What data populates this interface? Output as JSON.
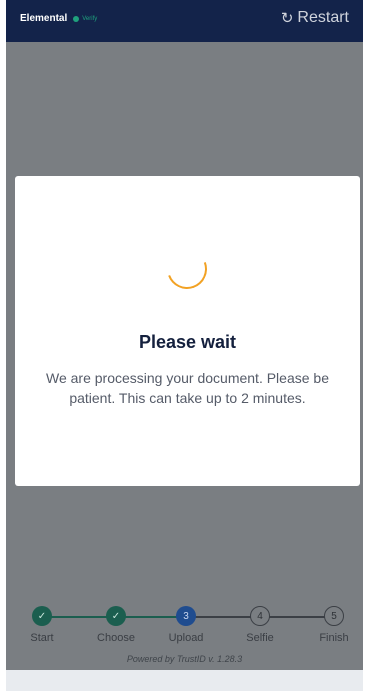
{
  "header": {
    "brand": "Elemental",
    "brand_sub": "Verify",
    "restart_icon": "restart-icon",
    "restart_label": "Restart"
  },
  "modal": {
    "title": "Please wait",
    "body": "We are processing your document. Please be patient. This can take up to 2 minutes.",
    "spinner_color": "#f2a224"
  },
  "stepper": {
    "steps": [
      {
        "number": "1",
        "label": "Start",
        "status": "done"
      },
      {
        "number": "2",
        "label": "Choose",
        "status": "done"
      },
      {
        "number": "3",
        "label": "Upload",
        "status": "active"
      },
      {
        "number": "4",
        "label": "Selfie",
        "status": "pending"
      },
      {
        "number": "5",
        "label": "Finish",
        "status": "pending"
      }
    ],
    "check_glyph": "✓",
    "powered_by": "Powered by TrustID v. 1.28.3"
  },
  "colors": {
    "header_bg": "#13234a",
    "done": "#1b5e4f",
    "active": "#1f4c8f",
    "overlay": "#7a7e82"
  }
}
